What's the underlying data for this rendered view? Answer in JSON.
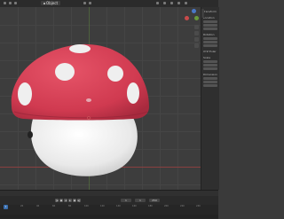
{
  "header": {
    "mode_label": "Object"
  },
  "npanel": {
    "sections": [
      "Transform",
      "Location",
      "Rotation",
      "XYZ Euler",
      "Scale",
      "Dimensions"
    ]
  },
  "timeline": {
    "start_frame": "1",
    "end_frame": "250",
    "current_frame": "1",
    "ruler_ticks": [
      "0",
      "20",
      "40",
      "60",
      "80",
      "100",
      "120",
      "140",
      "160",
      "180",
      "200",
      "220",
      "240"
    ]
  },
  "colors": {
    "cap_red": "#d63a50",
    "spot_white": "#eeeeee",
    "stem_white": "#efefef",
    "viewport_bg": "#3d3d3d"
  },
  "icons": {
    "gizmo": "navigation-gizmo-icon",
    "zoom": "zoom-icon",
    "pan": "pan-hand-icon",
    "camera": "camera-view-icon",
    "grid": "ortho-grid-icon"
  }
}
